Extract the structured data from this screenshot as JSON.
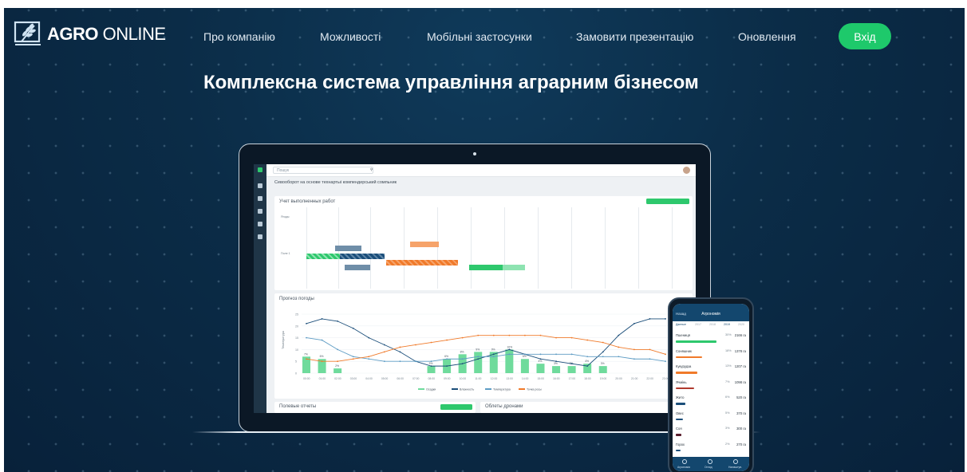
{
  "brand": {
    "name_bold": "AGRO",
    "name_light": " ONLINE",
    "logo_icon": "wheat-logo-icon"
  },
  "nav": {
    "items": [
      {
        "label": "Про компанію"
      },
      {
        "label": "Можливості"
      },
      {
        "label": "Мобільні застосунки"
      },
      {
        "label": "Замовити презентацію"
      },
      {
        "label": "Оновлення"
      }
    ],
    "login_label": "Вхід"
  },
  "hero": {
    "title": "Комплексна система управління аграрним бізнесом"
  },
  "colors": {
    "accent": "#1ec96b",
    "background": "#0b2c47",
    "chart_orange": "#f07a2a",
    "chart_blue": "#1b4e7a"
  },
  "app": {
    "search_placeholder": "Пошук",
    "crop_rotation_title": "Севооборот на основе технартыі компендерський сомпьник",
    "work_log_title": "Учет выполненных работ",
    "forecast_title": "Прогноз погоды",
    "field_reports_title": "Полевые отчеты",
    "drone_title": "Облеты дронами"
  },
  "phone": {
    "title": "Агрономія",
    "back_label": "Назад",
    "tabs": [
      "Данные",
      "2017",
      "2018",
      "2019",
      "2020"
    ],
    "rows": [
      {
        "name": "Пшениця",
        "pct": "30%",
        "value": "2166 га",
        "color": "#2ec86d",
        "fill": 0.85
      },
      {
        "name": "Соняшник",
        "pct": "18%",
        "value": "1378 га",
        "color": "#f07a2a",
        "fill": 0.55
      },
      {
        "name": "Кукурудза",
        "pct": "13%",
        "value": "1207 га",
        "color": "#f07a2a",
        "fill": 0.45
      },
      {
        "name": "Ячмінь",
        "pct": "7%",
        "value": "1098 га",
        "color": "#b03a2e",
        "fill": 0.38
      },
      {
        "name": "Жито",
        "pct": "6%",
        "value": "520 га",
        "color": "#1b4e7a",
        "fill": 0.2
      },
      {
        "name": "Овес",
        "pct": "5%",
        "value": "370 га",
        "color": "#1b4e7a",
        "fill": 0.15
      },
      {
        "name": "Соя",
        "pct": "3%",
        "value": "300 га",
        "color": "#5a1e2e",
        "fill": 0.12
      },
      {
        "name": "Горох",
        "pct": "2%",
        "value": "270 га",
        "color": "#1b4e7a",
        "fill": 0.1
      }
    ],
    "bottom_nav": [
      "Агрономія",
      "Огляд",
      "Налаштув."
    ]
  },
  "chart_data": {
    "type": "bar",
    "categories": [
      "00:00",
      "01:00",
      "02:00",
      "03:00",
      "04:00",
      "05:00",
      "06:00",
      "07:00",
      "08:00",
      "09:00",
      "10:00",
      "11:00",
      "12:00",
      "13:00",
      "14:00",
      "15:00",
      "16:00",
      "17:00",
      "18:00",
      "19:00",
      "20:00",
      "21:00",
      "22:00",
      "23:00"
    ],
    "series": [
      {
        "name": "Осадки",
        "values": [
          7,
          6,
          2,
          0,
          0,
          0,
          0,
          0,
          3,
          6,
          8,
          9,
          9,
          10,
          6,
          4,
          3,
          3,
          4,
          3,
          0,
          0,
          0,
          0
        ]
      },
      {
        "name": "Влажность",
        "values": [
          21,
          23,
          22,
          19,
          15,
          12,
          9,
          5,
          3,
          3,
          4,
          6,
          8,
          10,
          8,
          6,
          5,
          4,
          3,
          9,
          16,
          21,
          23,
          23
        ]
      },
      {
        "name": "Температура",
        "values": [
          15,
          14,
          10,
          7,
          6,
          5,
          5,
          5,
          5,
          6,
          6,
          7,
          7,
          8,
          8,
          8,
          8,
          8,
          7,
          7,
          7,
          6,
          6,
          5
        ]
      },
      {
        "name": "Точка росы",
        "values": [
          6,
          5,
          5,
          6,
          7,
          9,
          11,
          12,
          13,
          14,
          15,
          16,
          16,
          16,
          16,
          16,
          15,
          15,
          14,
          13,
          11,
          10,
          10,
          8
        ]
      }
    ],
    "ylim": [
      0,
      25
    ],
    "ylabel": "Температура"
  }
}
